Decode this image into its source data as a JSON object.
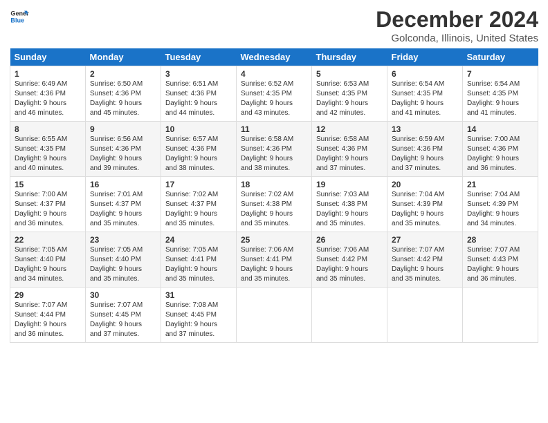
{
  "header": {
    "logo_line1": "General",
    "logo_line2": "Blue",
    "month": "December 2024",
    "location": "Golconda, Illinois, United States"
  },
  "days_of_week": [
    "Sunday",
    "Monday",
    "Tuesday",
    "Wednesday",
    "Thursday",
    "Friday",
    "Saturday"
  ],
  "weeks": [
    [
      {
        "day": "1",
        "info": "Sunrise: 6:49 AM\nSunset: 4:36 PM\nDaylight: 9 hours\nand 46 minutes."
      },
      {
        "day": "2",
        "info": "Sunrise: 6:50 AM\nSunset: 4:36 PM\nDaylight: 9 hours\nand 45 minutes."
      },
      {
        "day": "3",
        "info": "Sunrise: 6:51 AM\nSunset: 4:36 PM\nDaylight: 9 hours\nand 44 minutes."
      },
      {
        "day": "4",
        "info": "Sunrise: 6:52 AM\nSunset: 4:35 PM\nDaylight: 9 hours\nand 43 minutes."
      },
      {
        "day": "5",
        "info": "Sunrise: 6:53 AM\nSunset: 4:35 PM\nDaylight: 9 hours\nand 42 minutes."
      },
      {
        "day": "6",
        "info": "Sunrise: 6:54 AM\nSunset: 4:35 PM\nDaylight: 9 hours\nand 41 minutes."
      },
      {
        "day": "7",
        "info": "Sunrise: 6:54 AM\nSunset: 4:35 PM\nDaylight: 9 hours\nand 41 minutes."
      }
    ],
    [
      {
        "day": "8",
        "info": "Sunrise: 6:55 AM\nSunset: 4:35 PM\nDaylight: 9 hours\nand 40 minutes."
      },
      {
        "day": "9",
        "info": "Sunrise: 6:56 AM\nSunset: 4:36 PM\nDaylight: 9 hours\nand 39 minutes."
      },
      {
        "day": "10",
        "info": "Sunrise: 6:57 AM\nSunset: 4:36 PM\nDaylight: 9 hours\nand 38 minutes."
      },
      {
        "day": "11",
        "info": "Sunrise: 6:58 AM\nSunset: 4:36 PM\nDaylight: 9 hours\nand 38 minutes."
      },
      {
        "day": "12",
        "info": "Sunrise: 6:58 AM\nSunset: 4:36 PM\nDaylight: 9 hours\nand 37 minutes."
      },
      {
        "day": "13",
        "info": "Sunrise: 6:59 AM\nSunset: 4:36 PM\nDaylight: 9 hours\nand 37 minutes."
      },
      {
        "day": "14",
        "info": "Sunrise: 7:00 AM\nSunset: 4:36 PM\nDaylight: 9 hours\nand 36 minutes."
      }
    ],
    [
      {
        "day": "15",
        "info": "Sunrise: 7:00 AM\nSunset: 4:37 PM\nDaylight: 9 hours\nand 36 minutes."
      },
      {
        "day": "16",
        "info": "Sunrise: 7:01 AM\nSunset: 4:37 PM\nDaylight: 9 hours\nand 35 minutes."
      },
      {
        "day": "17",
        "info": "Sunrise: 7:02 AM\nSunset: 4:37 PM\nDaylight: 9 hours\nand 35 minutes."
      },
      {
        "day": "18",
        "info": "Sunrise: 7:02 AM\nSunset: 4:38 PM\nDaylight: 9 hours\nand 35 minutes."
      },
      {
        "day": "19",
        "info": "Sunrise: 7:03 AM\nSunset: 4:38 PM\nDaylight: 9 hours\nand 35 minutes."
      },
      {
        "day": "20",
        "info": "Sunrise: 7:04 AM\nSunset: 4:39 PM\nDaylight: 9 hours\nand 35 minutes."
      },
      {
        "day": "21",
        "info": "Sunrise: 7:04 AM\nSunset: 4:39 PM\nDaylight: 9 hours\nand 34 minutes."
      }
    ],
    [
      {
        "day": "22",
        "info": "Sunrise: 7:05 AM\nSunset: 4:40 PM\nDaylight: 9 hours\nand 34 minutes."
      },
      {
        "day": "23",
        "info": "Sunrise: 7:05 AM\nSunset: 4:40 PM\nDaylight: 9 hours\nand 35 minutes."
      },
      {
        "day": "24",
        "info": "Sunrise: 7:05 AM\nSunset: 4:41 PM\nDaylight: 9 hours\nand 35 minutes."
      },
      {
        "day": "25",
        "info": "Sunrise: 7:06 AM\nSunset: 4:41 PM\nDaylight: 9 hours\nand 35 minutes."
      },
      {
        "day": "26",
        "info": "Sunrise: 7:06 AM\nSunset: 4:42 PM\nDaylight: 9 hours\nand 35 minutes."
      },
      {
        "day": "27",
        "info": "Sunrise: 7:07 AM\nSunset: 4:42 PM\nDaylight: 9 hours\nand 35 minutes."
      },
      {
        "day": "28",
        "info": "Sunrise: 7:07 AM\nSunset: 4:43 PM\nDaylight: 9 hours\nand 36 minutes."
      }
    ],
    [
      {
        "day": "29",
        "info": "Sunrise: 7:07 AM\nSunset: 4:44 PM\nDaylight: 9 hours\nand 36 minutes."
      },
      {
        "day": "30",
        "info": "Sunrise: 7:07 AM\nSunset: 4:45 PM\nDaylight: 9 hours\nand 37 minutes."
      },
      {
        "day": "31",
        "info": "Sunrise: 7:08 AM\nSunset: 4:45 PM\nDaylight: 9 hours\nand 37 minutes."
      },
      {
        "day": "",
        "info": ""
      },
      {
        "day": "",
        "info": ""
      },
      {
        "day": "",
        "info": ""
      },
      {
        "day": "",
        "info": ""
      }
    ]
  ]
}
